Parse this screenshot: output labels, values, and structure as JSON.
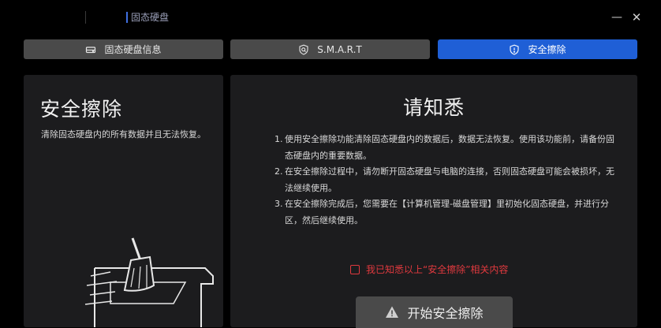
{
  "window": {
    "title": "固态硬盘",
    "minimize_glyph": "—",
    "close_glyph": "✕"
  },
  "tabs": [
    {
      "label": "固态硬盘信息",
      "icon": "drive-icon",
      "active": false
    },
    {
      "label": "S.M.A.R.T",
      "icon": "shield-search-icon",
      "active": false
    },
    {
      "label": "安全擦除",
      "icon": "shield-alert-icon",
      "active": true
    }
  ],
  "left_panel": {
    "title": "安全擦除",
    "description": "清除固态硬盘内的所有数据并且无法恢复。"
  },
  "notice": {
    "title": "请知悉",
    "items": [
      {
        "num": "1.",
        "text": "使用安全擦除功能清除固态硬盘内的数据后，数据无法恢复。使用该功能前，请备份固态硬盘内的重要数据。"
      },
      {
        "num": "2.",
        "text": "在安全擦除过程中，请勿断开固态硬盘与电脑的连接，否则固态硬盘可能会被损坏，无法继续使用。"
      },
      {
        "num": "3.",
        "text": "在安全擦除完成后，您需要在【计算机管理-磁盘管理】里初始化固态硬盘，并进行分区，然后继续使用。"
      }
    ],
    "agree_label": "我已知悉以上“安全擦除”相关内容",
    "agree_checked": false,
    "start_button": "开始安全擦除"
  },
  "colors": {
    "accent": "#1f5fd6",
    "warning": "#e0393e"
  }
}
